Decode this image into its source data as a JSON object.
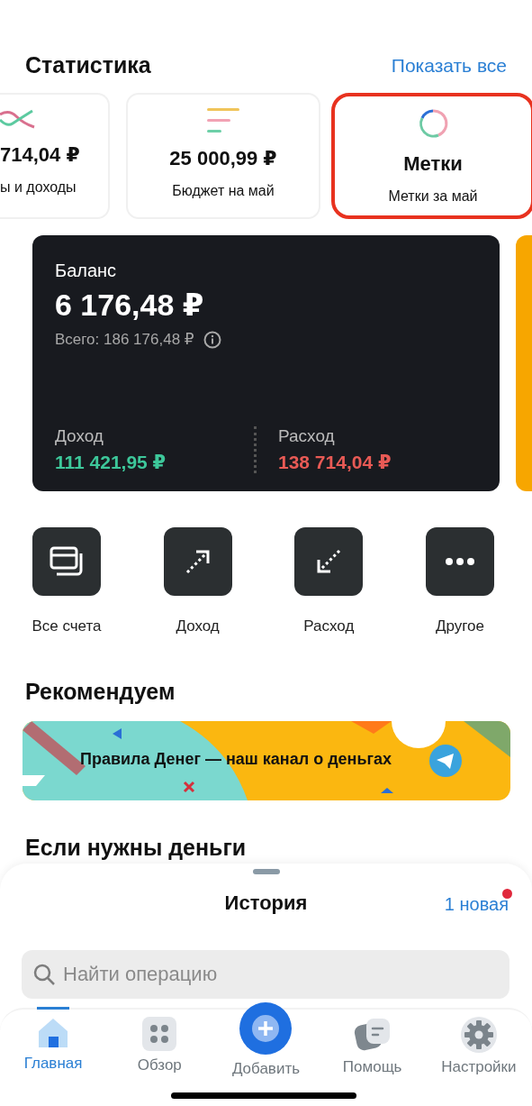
{
  "statistics": {
    "title": "Статистика",
    "show_all": "Показать все",
    "cards": [
      {
        "kind": "lines",
        "value": "714,04 ₽",
        "caption": "ы и доходы",
        "highlighted": false
      },
      {
        "kind": "bars",
        "value": "25 000,99 ₽",
        "caption": "Бюджет на май",
        "highlighted": false
      },
      {
        "kind": "ring",
        "value": "Метки",
        "caption": "Метки за май",
        "highlighted": true
      }
    ]
  },
  "balance": {
    "label": "Баланс",
    "amount": "6 176,48 ₽",
    "total": "Всего: 186 176,48 ₽",
    "income_label": "Доход",
    "income": "111 421,95 ₽",
    "expense_label": "Расход",
    "expense": "138 714,04 ₽"
  },
  "actions": [
    {
      "kind": "accounts",
      "label": "Все счета"
    },
    {
      "kind": "income",
      "label": "Доход"
    },
    {
      "kind": "expense",
      "label": "Расход"
    },
    {
      "kind": "more",
      "label": "Другое"
    }
  ],
  "recommend": {
    "title": "Рекомендуем",
    "banner_text": "Правила Денег — наш канал о деньгах"
  },
  "money_title": "Если нужны деньги",
  "history": {
    "title": "История",
    "new_link": "1 новая",
    "unread": true,
    "search": {
      "placeholder": "Найти операцию"
    }
  },
  "tabs": [
    {
      "kind": "home",
      "label": "Главная",
      "selected": true
    },
    {
      "kind": "overview",
      "label": "Обзор",
      "selected": false
    },
    {
      "kind": "add",
      "label": "Добавить",
      "selected": false
    },
    {
      "kind": "help",
      "label": "Помощь",
      "selected": false
    },
    {
      "kind": "settings",
      "label": "Настройки",
      "selected": false
    }
  ]
}
